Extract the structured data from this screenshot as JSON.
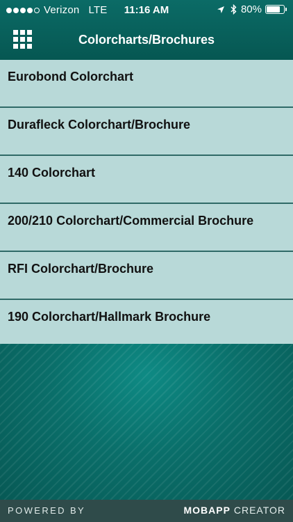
{
  "status_bar": {
    "signal_filled": 4,
    "signal_total": 5,
    "carrier": "Verizon",
    "network": "LTE",
    "time": "11:16 AM",
    "location_icon": "location-arrow-icon",
    "bluetooth_icon": "bluetooth-icon",
    "battery_percent": "80%",
    "battery_level": 0.8
  },
  "nav_bar": {
    "menu_icon": "grid-menu-icon",
    "title": "Colorcharts/Brochures"
  },
  "list": {
    "items": [
      {
        "label": "Eurobond Colorchart"
      },
      {
        "label": "Durafleck Colorchart/Brochure"
      },
      {
        "label": "140 Colorchart"
      },
      {
        "label": "200/210 Colorchart/Commercial Brochure"
      },
      {
        "label": "RFI Colorchart/Brochure"
      },
      {
        "label": "190 Colorchart/Hallmark Brochure"
      }
    ]
  },
  "footer": {
    "powered_by": "POWERED BY",
    "brand_strong": "MOBAPP",
    "brand_light": "CREATOR"
  },
  "colors": {
    "header_bg": "#0b6b66",
    "list_bg": "#b8d9d8",
    "divider": "#2f6a67",
    "footer_bg": "#2f4b4a"
  }
}
